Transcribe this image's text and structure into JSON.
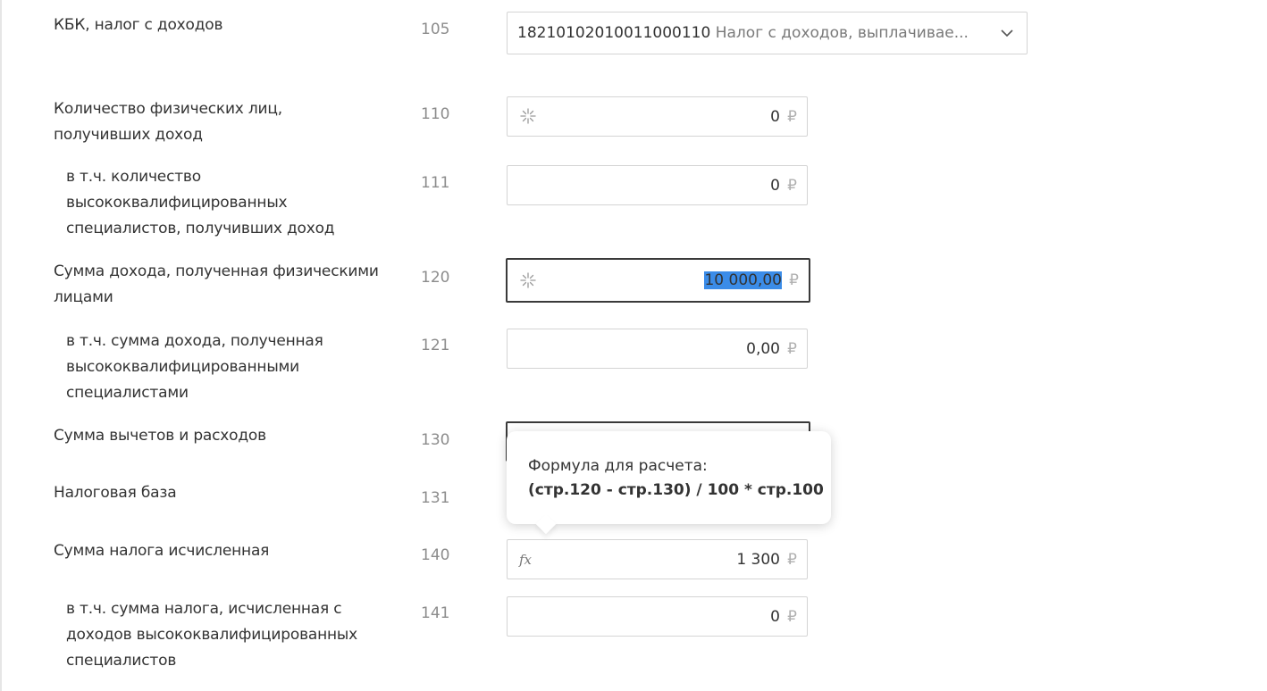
{
  "rows": {
    "kbk": {
      "label": "КБК, налог с доходов",
      "code": "105"
    },
    "r110": {
      "label_lines": [
        "Количество физических лиц,",
        "получивших доход"
      ],
      "code": "110",
      "value": "0",
      "currency": "₽"
    },
    "r111": {
      "label_lines": [
        "в т.ч. количество",
        "высококвалифицированных",
        "специалистов, получивших доход"
      ],
      "code": "111",
      "value": "0",
      "currency": "₽"
    },
    "r120": {
      "label_lines": [
        "Сумма дохода, полученная физическими",
        "лицами"
      ],
      "code": "120",
      "value": "10 000,00",
      "currency": "₽"
    },
    "r121": {
      "label_lines": [
        "в т.ч. сумма дохода, полученная",
        "высококвалифицированными",
        "специалистами"
      ],
      "code": "121",
      "value": "0,00",
      "currency": "₽"
    },
    "r130": {
      "label": "Сумма вычетов и расходов",
      "code": "130"
    },
    "r131": {
      "label": "Налоговая база",
      "code": "131"
    },
    "r140": {
      "label": "Сумма налога исчисленная",
      "code": "140",
      "value": "1 300",
      "currency": "₽"
    },
    "r141": {
      "label_lines": [
        "в т.ч. сумма налога, исчисленная с",
        "доходов высококвалифицированных",
        "специалистов"
      ],
      "code": "141",
      "value": "0",
      "currency": "₽"
    }
  },
  "kbk_dropdown": {
    "code": "18210102010011000110",
    "description": "Налог с доходов, выплачивае..."
  },
  "tooltip": {
    "title": "Формула для расчета:",
    "formula": "(стр.120 - стр.130) / 100 * стр.100"
  },
  "icons": {
    "auto_calc": "sparkle-icon",
    "formula": "fx-icon",
    "dropdown": "chevron-down-icon"
  },
  "colors": {
    "selection": "#3b8ce8",
    "focused_border": "#3a3a3a",
    "field_border": "#d4d4d4",
    "label_text": "#333333",
    "code_text": "#8c8c8c"
  },
  "fx_glyph": "fx"
}
